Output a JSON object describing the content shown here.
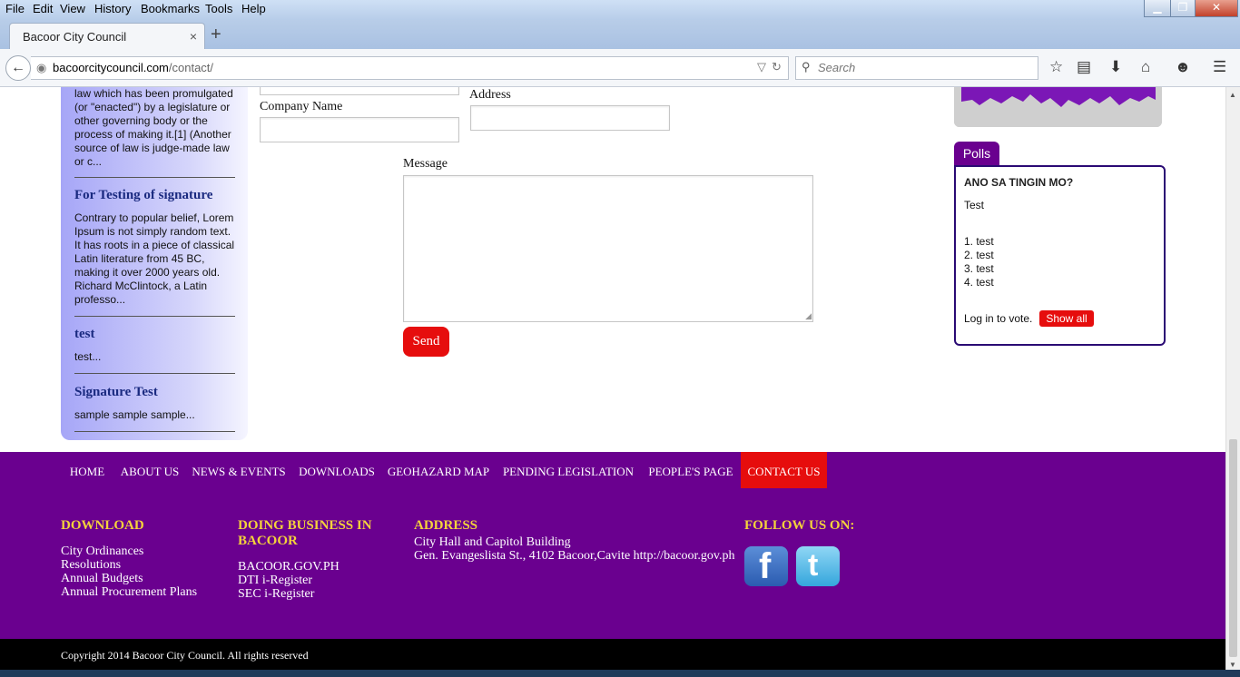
{
  "menubar": {
    "items": [
      "File",
      "Edit",
      "View",
      "History",
      "Bookmarks",
      "Tools",
      "Help"
    ]
  },
  "tab": {
    "title": "Bacoor City Council",
    "close": "×",
    "new": "+"
  },
  "address": {
    "domain": "bacoorcitycouncil.com",
    "path": "/contact/"
  },
  "search": {
    "placeholder": "Search"
  },
  "sidebar": {
    "items": [
      {
        "excerpt": "law which has been promulgated (or \"enacted\") by a legislature or other governing body or the process of making it.[1] (Another source of law is judge-made law or c..."
      },
      {
        "title": "For Testing of signature",
        "excerpt": "Contrary to popular belief, Lorem Ipsum is not simply random text. It has roots in a piece of classical Latin literature from 45 BC, making it over 2000 years old. Richard McClintock, a Latin professo..."
      },
      {
        "title": "test",
        "excerpt": "test..."
      },
      {
        "title": "Signature Test",
        "excerpt": "sample sample sample..."
      }
    ]
  },
  "form": {
    "company_label": "Company Name",
    "address_label": "Address",
    "message_label": "Message",
    "send": "Send"
  },
  "polls": {
    "tab": "Polls",
    "question": "ANO SA TINGIN MO?",
    "description": "Test",
    "options": [
      "1. test",
      "2. test",
      "3. test",
      "4. test"
    ],
    "login_text": "Log in to vote.",
    "show_all": "Show all"
  },
  "footer": {
    "nav": [
      "HOME",
      "ABOUT US",
      "NEWS & EVENTS",
      "DOWNLOADS",
      "GEOHAZARD MAP",
      "PENDING LEGISLATION",
      "PEOPLE'S PAGE",
      "CONTACT US"
    ],
    "download": {
      "heading": "DOWNLOAD",
      "links": [
        "City Ordinances",
        "Resolutions",
        "Annual Budgets",
        "Annual Procurement Plans"
      ]
    },
    "business": {
      "heading1": "DOING BUSINESS IN",
      "heading2": "BACOOR",
      "links": [
        "BACOOR.GOV.PH",
        "DTI i-Register",
        "SEC i-Register"
      ]
    },
    "address": {
      "heading": "ADDRESS",
      "line1": "City Hall and Capitol Building",
      "line2": "Gen. Evangeslista St., 4102 Bacoor,Cavite http://bacoor.gov.ph"
    },
    "follow": {
      "heading": "FOLLOW US ON:",
      "icons": [
        "facebook-icon",
        "twitter-icon"
      ]
    },
    "copyright": "Copyright 2014 Bacoor City Council. All rights reserved"
  },
  "colors": {
    "purple": "#6a008f",
    "red": "#e60d0d",
    "gold": "#f4d23b"
  }
}
